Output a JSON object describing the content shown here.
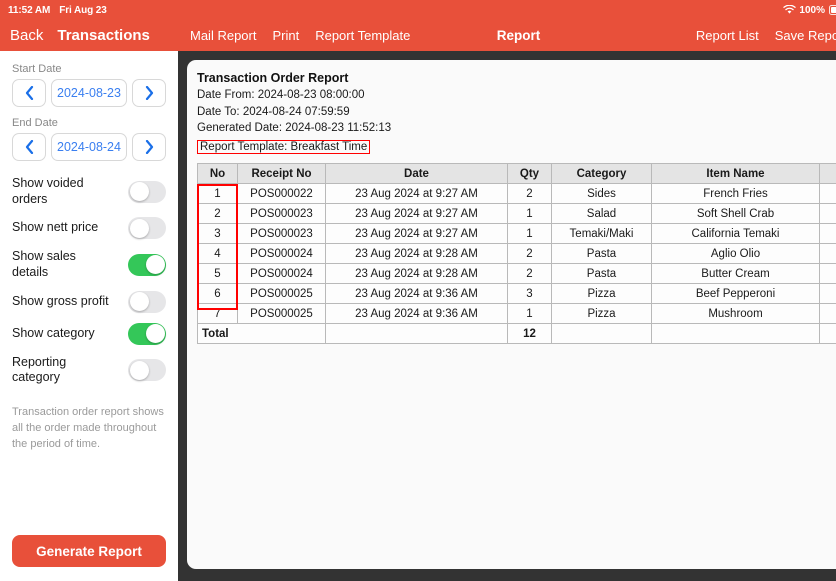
{
  "status_bar": {
    "time": "11:52 AM",
    "date": "Fri Aug 23",
    "wifi_icon": "wifi-icon",
    "battery_percent": "100%",
    "battery_icon": "battery-full-icon"
  },
  "sidebar": {
    "back_label": "Back",
    "title": "Transactions",
    "start_date": {
      "label": "Start Date",
      "prev_icon": "chevron-left-icon",
      "next_icon": "chevron-right-icon",
      "value": "2024-08-23"
    },
    "end_date": {
      "label": "End Date",
      "prev_icon": "chevron-left-icon",
      "next_icon": "chevron-right-icon",
      "value": "2024-08-24"
    },
    "toggles": [
      {
        "label": "Show voided orders",
        "on": false
      },
      {
        "label": "Show nett price",
        "on": false
      },
      {
        "label": "Show sales details",
        "on": true
      },
      {
        "label": "Show gross profit",
        "on": false
      },
      {
        "label": "Show category",
        "on": true
      },
      {
        "label": "Reporting category",
        "on": false
      }
    ],
    "note": "Transaction order report shows all the order made throughout the period of time.",
    "generate_button": "Generate Report"
  },
  "toolbar": {
    "left_items": [
      "Mail Report",
      "Print",
      "Report Template"
    ],
    "center_title": "Report",
    "right_items": [
      "Report List",
      "Save Report"
    ]
  },
  "report": {
    "title": "Transaction Order Report",
    "date_from": "Date From: 2024-08-23 08:00:00",
    "date_to": "Date To: 2024-08-24 07:59:59",
    "generated_date": "Generated Date: 2024-08-23 11:52:13",
    "template": "Report Template: Breakfast Time",
    "highlight_color": "#ff0000",
    "columns": [
      "No",
      "Receipt No",
      "Date",
      "Qty",
      "Category",
      "Item Name",
      ""
    ],
    "rows": [
      {
        "no": "1",
        "receipt": "POS000022",
        "date": "23 Aug 2024 at 9:27 AM",
        "qty": "2",
        "category": "Sides",
        "item": "French Fries",
        "extra": ""
      },
      {
        "no": "2",
        "receipt": "POS000023",
        "date": "23 Aug 2024 at 9:27 AM",
        "qty": "1",
        "category": "Salad",
        "item": "Soft Shell Crab",
        "extra": ""
      },
      {
        "no": "3",
        "receipt": "POS000023",
        "date": "23 Aug 2024 at 9:27 AM",
        "qty": "1",
        "category": "Temaki/Maki",
        "item": "California Temaki",
        "extra": ""
      },
      {
        "no": "4",
        "receipt": "POS000024",
        "date": "23 Aug 2024 at 9:28 AM",
        "qty": "2",
        "category": "Pasta",
        "item": "Aglio Olio",
        "extra": ""
      },
      {
        "no": "5",
        "receipt": "POS000024",
        "date": "23 Aug 2024 at 9:28 AM",
        "qty": "2",
        "category": "Pasta",
        "item": "Butter Cream",
        "extra": ""
      },
      {
        "no": "6",
        "receipt": "POS000025",
        "date": "23 Aug 2024 at 9:36 AM",
        "qty": "3",
        "category": "Pizza",
        "item": "Beef Pepperoni",
        "extra": ""
      },
      {
        "no": "7",
        "receipt": "POS000025",
        "date": "23 Aug 2024 at 9:36 AM",
        "qty": "1",
        "category": "Pizza",
        "item": "Mushroom",
        "extra": ""
      }
    ],
    "total": {
      "label": "Total",
      "receipt": "",
      "date": "",
      "qty": "12",
      "category": "",
      "item": "",
      "extra": ""
    }
  },
  "theme": {
    "accent": "#e8503a",
    "switch_on": "#34c759",
    "switch_off": "#e6e6e8",
    "link_blue": "#3a7ff0",
    "canvas_dark": "#333333"
  }
}
